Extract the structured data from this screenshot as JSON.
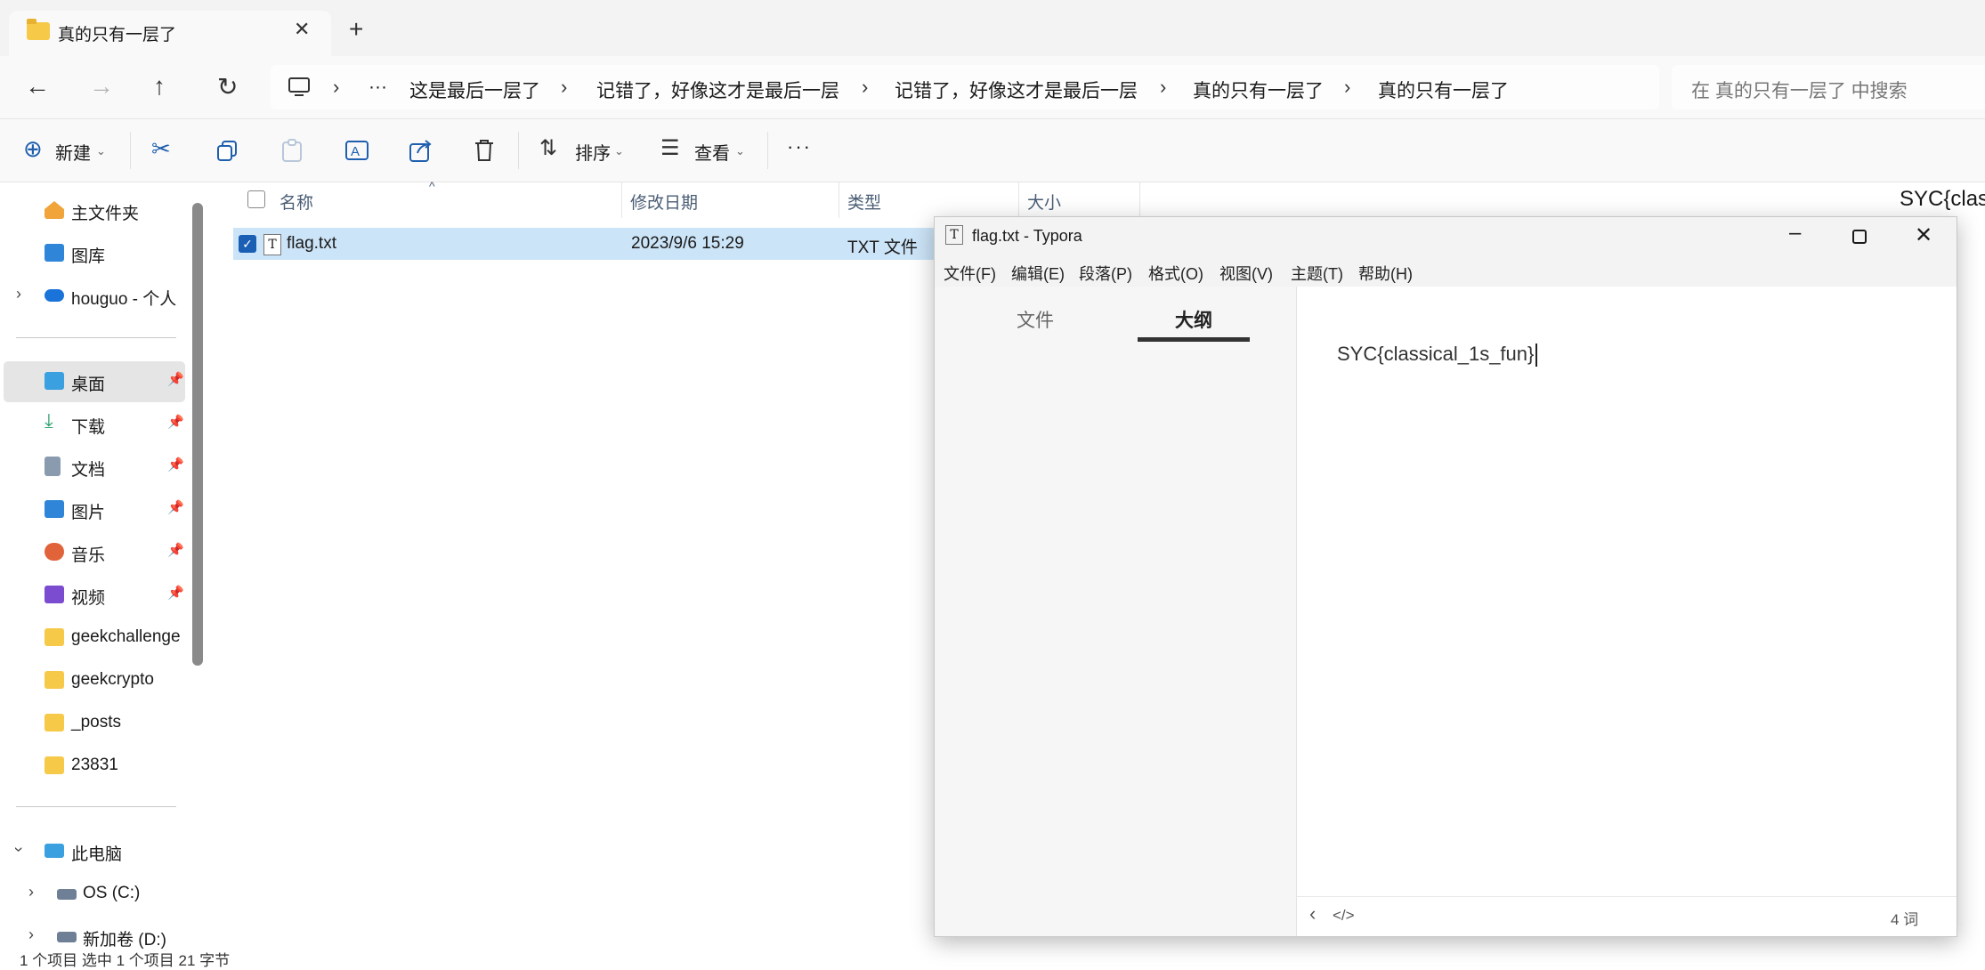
{
  "tab": {
    "title": "真的只有一层了",
    "close": "✕",
    "new": "+"
  },
  "nav": {
    "back": "←",
    "forward": "→",
    "up": "↑",
    "refresh": "↻"
  },
  "breadcrumbs": [
    "这是最后一层了",
    "记错了，好像这才是最后一层",
    "记错了，好像这才是最后一层",
    "真的只有一层了",
    "真的只有一层了"
  ],
  "breadcrumb_more": "···",
  "breadcrumb_sep": "›",
  "search": {
    "placeholder": "在 真的只有一层了 中搜索"
  },
  "toolbar": {
    "new_label": "新建",
    "sort_label": "排序",
    "view_label": "查看",
    "more": "···"
  },
  "sidebar": {
    "items": [
      {
        "label": "主文件夹",
        "icon": "home-icon"
      },
      {
        "label": "图库",
        "icon": "gallery-icon"
      },
      {
        "label": "houguo - 个人",
        "icon": "onedrive-icon"
      },
      {
        "label": "桌面",
        "icon": "desktop-icon",
        "pinned": true
      },
      {
        "label": "下载",
        "icon": "download-icon",
        "pinned": true
      },
      {
        "label": "文档",
        "icon": "document-icon",
        "pinned": true
      },
      {
        "label": "图片",
        "icon": "picture-icon",
        "pinned": true
      },
      {
        "label": "音乐",
        "icon": "music-icon",
        "pinned": true
      },
      {
        "label": "视频",
        "icon": "video-icon",
        "pinned": true
      },
      {
        "label": "geekchallenge",
        "icon": "folder-icon"
      },
      {
        "label": "geekcrypto",
        "icon": "folder-icon"
      },
      {
        "label": "_posts",
        "icon": "folder-icon"
      },
      {
        "label": "23831",
        "icon": "folder-icon"
      },
      {
        "label": "此电脑",
        "icon": "pc-icon"
      },
      {
        "label": "OS (C:)",
        "icon": "drive-icon"
      },
      {
        "label": "新加卷 (D:)",
        "icon": "drive-icon"
      }
    ]
  },
  "columns": {
    "name": "名称",
    "date": "修改日期",
    "type": "类型",
    "size": "大小"
  },
  "files": [
    {
      "name": "flag.txt",
      "date": "2023/9/6 15:29",
      "type": "TXT 文件"
    }
  ],
  "preview_text": "SYC{clas",
  "status": "1 个项目    选中 1 个项目  21 字节",
  "typora": {
    "title": "flag.txt - Typora",
    "menu": [
      "文件(F)",
      "编辑(E)",
      "段落(P)",
      "格式(O)",
      "视图(V)",
      "主题(T)",
      "帮助(H)"
    ],
    "side_tabs": [
      "文件",
      "大纲"
    ],
    "content": "SYC{classical_1s_fun}",
    "word_count": "4 词",
    "footer_back": "‹",
    "footer_code": "</>"
  },
  "colors": {
    "selection": "#cce4f7",
    "accent": "#1f5fae",
    "folder": "#f7c948"
  }
}
